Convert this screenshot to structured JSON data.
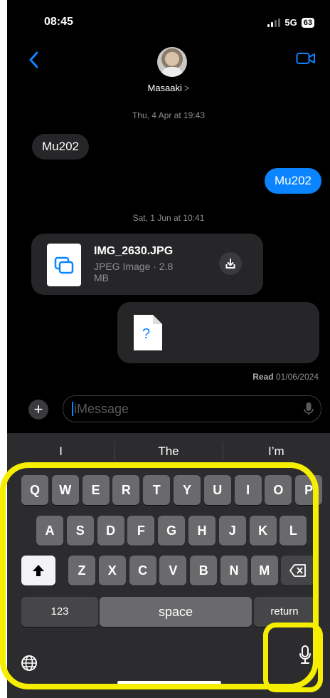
{
  "status_bar": {
    "time": "08:45",
    "network": "5G",
    "battery": "63"
  },
  "header": {
    "contact_name": "Masaaki",
    "chevron": ">"
  },
  "messages": {
    "timestamp_1": "Thu, 4 Apr at 19:43",
    "incoming_1": "Mu202",
    "outgoing_1": "Mu202",
    "timestamp_2": "Sat, 1 Jun at 10:41",
    "file": {
      "name": "IMG_2630.JPG",
      "meta": "JPEG Image · 2.8 MB"
    },
    "missing_file_glyph": "?",
    "receipt_label": "Read",
    "receipt_date": "01/06/2024"
  },
  "composer": {
    "placeholder": "iMessage",
    "plus": "+"
  },
  "keyboard": {
    "suggestions": [
      "I",
      "The",
      "I’m"
    ],
    "row1": [
      "Q",
      "W",
      "E",
      "R",
      "T",
      "Y",
      "U",
      "I",
      "O",
      "P"
    ],
    "row2": [
      "A",
      "S",
      "D",
      "F",
      "G",
      "H",
      "J",
      "K",
      "L"
    ],
    "row3": [
      "Z",
      "X",
      "C",
      "V",
      "B",
      "N",
      "M"
    ],
    "numbers_label": "123",
    "space_label": "space",
    "return_label": "return"
  },
  "colors": {
    "accent": "#0a84ff",
    "highlight": "#f5ee00",
    "bubble_in": "#262628"
  },
  "icons": [
    "back-chevron-icon",
    "video-camera-icon",
    "download-icon",
    "document-icon",
    "mic-icon",
    "globe-icon",
    "shift-icon",
    "delete-icon",
    "plus-icon"
  ]
}
